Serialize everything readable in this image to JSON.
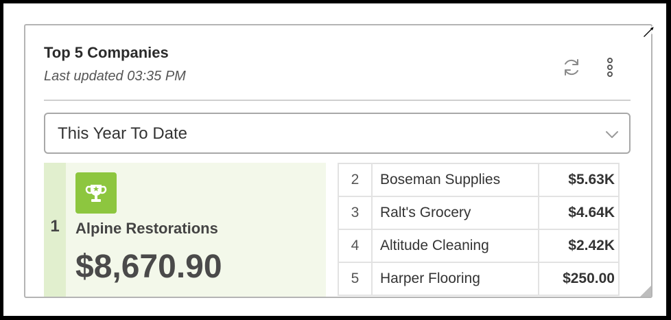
{
  "widget": {
    "title": "Top 5 Companies",
    "subtitle": "Last updated 03:35 PM",
    "refresh_icon": "refresh-icon",
    "menu_icon": "more-vertical-icon",
    "expand_icon": "expand-arrow-icon"
  },
  "range": {
    "selected": "This Year To Date",
    "icon": "chevron-down-icon"
  },
  "top_company": {
    "rank": "1",
    "name": "Alpine Restorations",
    "amount": "$8,670.90",
    "icon": "trophy-icon",
    "accent": "#8dc63f"
  },
  "companies": [
    {
      "rank": "2",
      "name": "Boseman Supplies",
      "amount": "$5.63K"
    },
    {
      "rank": "3",
      "name": "Ralt's Grocery",
      "amount": "$4.64K"
    },
    {
      "rank": "4",
      "name": "Altitude Cleaning",
      "amount": "$2.42K"
    },
    {
      "rank": "5",
      "name": "Harper Flooring",
      "amount": "$250.00"
    }
  ]
}
